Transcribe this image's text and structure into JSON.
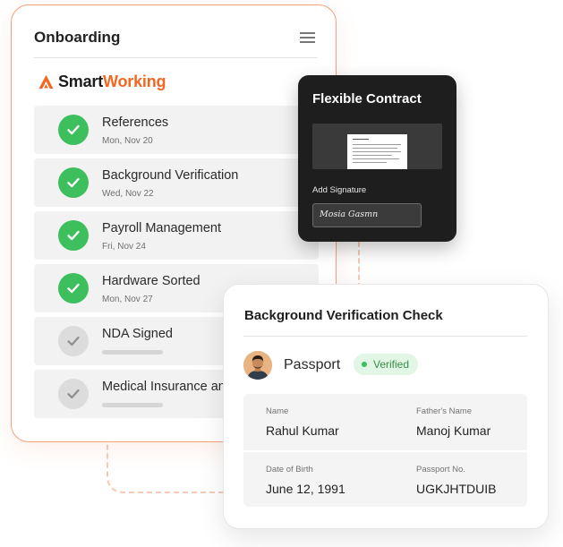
{
  "onboarding": {
    "title": "Onboarding",
    "brand": {
      "part1": "Smart",
      "part2": "Working",
      "accent": "#f26722"
    },
    "steps": [
      {
        "label": "References",
        "date": "Mon, Nov 20",
        "status": "done"
      },
      {
        "label": "Background Verification",
        "date": "Wed, Nov 22",
        "status": "done"
      },
      {
        "label": "Payroll Management",
        "date": "Fri, Nov 24",
        "status": "done"
      },
      {
        "label": "Hardware Sorted",
        "date": "Mon, Nov 27",
        "status": "done"
      },
      {
        "label": "NDA Signed",
        "date": "",
        "status": "pending"
      },
      {
        "label": "Medical Insurance an",
        "date": "",
        "status": "pending"
      }
    ]
  },
  "contract": {
    "title": "Flexible Contract",
    "signature_label": "Add Signature",
    "signature": "Mosia Gasmn"
  },
  "verification": {
    "title": "Background Verification Check",
    "document": "Passport",
    "status": "Verified",
    "fields": {
      "name_label": "Name",
      "name": "Rahul Kumar",
      "father_label": "Father's Name",
      "father": "Manoj Kumar",
      "dob_label": "Date of Birth",
      "dob": "June 12, 1991",
      "passport_label": "Passport No.",
      "passport": "UGKJHTDUIB"
    }
  },
  "colors": {
    "done": "#3cbf5c",
    "pending": "#dcdcdc",
    "card_border": "#f4a27d"
  }
}
